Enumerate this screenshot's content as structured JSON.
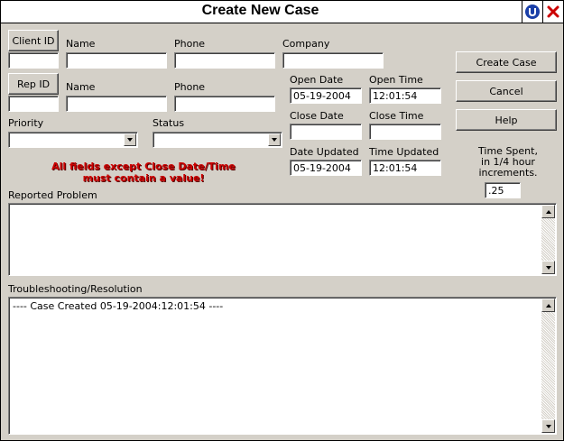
{
  "window": {
    "title": "Create New Case"
  },
  "client": {
    "button": "Client ID",
    "id_value": "",
    "name_label": "Name",
    "name_value": "",
    "phone_label": "Phone",
    "phone_value": "",
    "company_label": "Company",
    "company_value": ""
  },
  "rep": {
    "button": "Rep ID",
    "id_value": "",
    "name_label": "Name",
    "name_value": "",
    "phone_label": "Phone",
    "phone_value": ""
  },
  "dates": {
    "open_date_label": "Open Date",
    "open_date": "05-19-2004",
    "open_time_label": "Open Time",
    "open_time": "12:01:54",
    "close_date_label": "Close Date",
    "close_date": "",
    "close_time_label": "Close Time",
    "close_time": "",
    "updated_date_label": "Date Updated",
    "updated_date": "05-19-2004",
    "updated_time_label": "Time Updated",
    "updated_time": "12:01:54"
  },
  "priority": {
    "label": "Priority",
    "value": ""
  },
  "status": {
    "label": "Status",
    "value": ""
  },
  "warning": {
    "line1": "All fields except Close Date/Time",
    "line2": "must contain a value!"
  },
  "actions": {
    "create": "Create Case",
    "cancel": "Cancel",
    "help": "Help"
  },
  "time_spent": {
    "line1": "Time Spent,",
    "line2": "in 1/4 hour",
    "line3": "increments.",
    "value": ".25"
  },
  "reported_problem": {
    "label": "Reported Problem",
    "text": ""
  },
  "resolution": {
    "label": "Troubleshooting/Resolution",
    "text": "---- Case Created 05-19-2004:12:01:54 ----"
  },
  "colors": {
    "warning": "#cc0000",
    "face": "#d4d0c8",
    "info_icon": "#1a3fa8",
    "close_icon": "#cc0000"
  },
  "icons": {
    "info": "info-icon",
    "close": "close-icon"
  }
}
